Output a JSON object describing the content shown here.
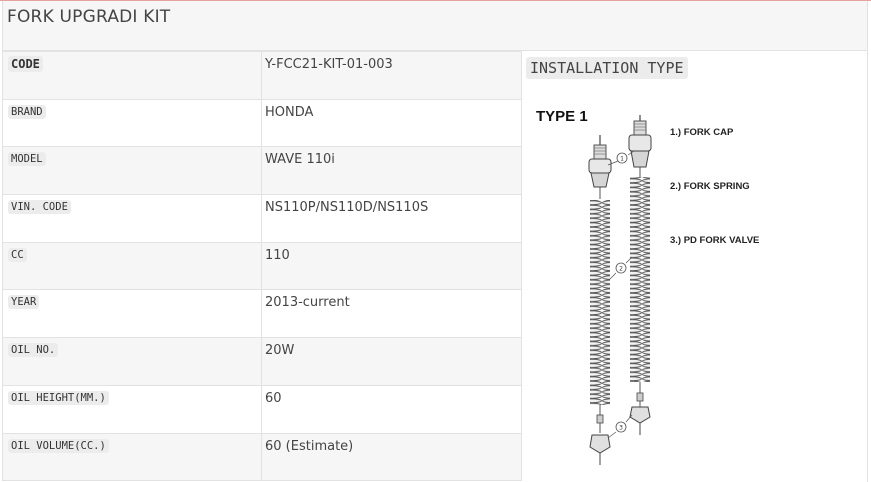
{
  "header": {
    "title": "FORK UPGRADI KIT"
  },
  "specs": [
    {
      "label": "CODE",
      "value": "Y-FCC21-KIT-01-003"
    },
    {
      "label": "BRAND",
      "value": "HONDA"
    },
    {
      "label": "MODEL",
      "value": "WAVE 110i"
    },
    {
      "label": "VIN. CODE",
      "value": "NS110P/NS110D/NS110S"
    },
    {
      "label": "CC",
      "value": "110"
    },
    {
      "label": "YEAR",
      "value": "2013-current"
    },
    {
      "label": "OIL NO.",
      "value": "20W"
    },
    {
      "label": "OIL HEIGHT(MM.)",
      "value": "60"
    },
    {
      "label": "OIL VOLUME(CC.)",
      "value": "60 (Estimate)"
    }
  ],
  "installation": {
    "title": "INSTALLATION TYPE",
    "type_label": "TYPE 1",
    "parts": [
      "1.) FORK CAP",
      "2.) FORK SPRING",
      "3.) PD FORK VALVE"
    ],
    "callouts": [
      "1",
      "2",
      "3"
    ]
  }
}
